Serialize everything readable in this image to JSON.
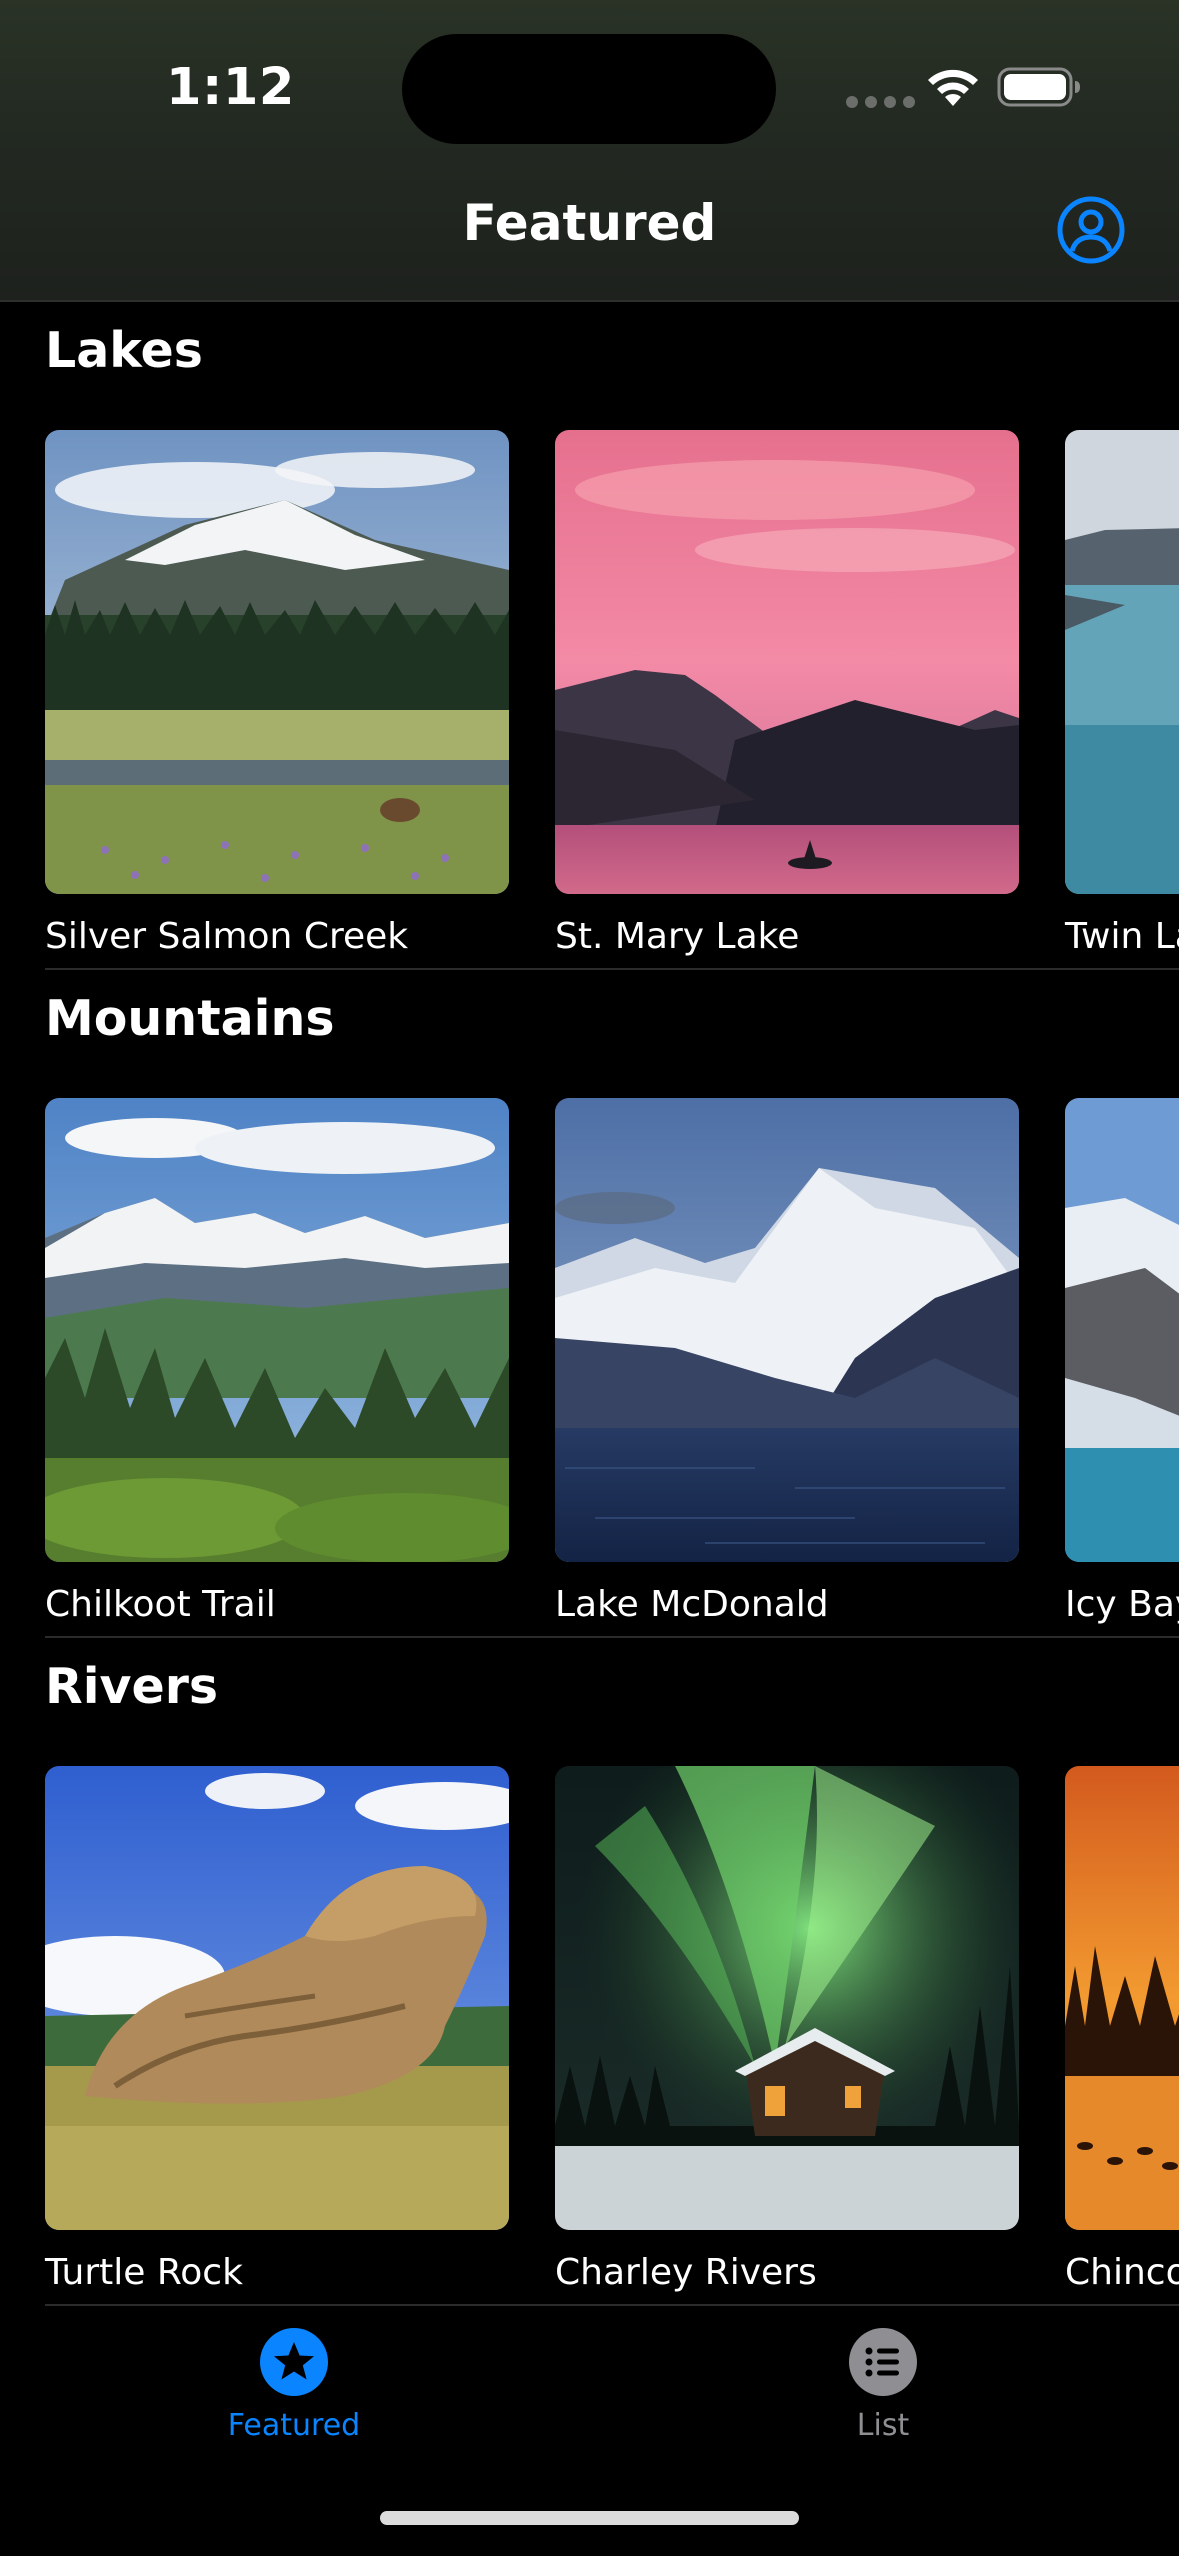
{
  "status_bar": {
    "time": "1:12"
  },
  "nav": {
    "title": "Featured",
    "profile_icon": "person-circle-icon"
  },
  "colors": {
    "accent": "#0a84ff",
    "inactive": "#8e8e93",
    "background": "#000000"
  },
  "sections": [
    {
      "title": "Lakes",
      "items": [
        {
          "name": "Silver Salmon Creek"
        },
        {
          "name": "St. Mary Lake"
        },
        {
          "name": "Twin Lake"
        }
      ]
    },
    {
      "title": "Mountains",
      "items": [
        {
          "name": "Chilkoot Trail"
        },
        {
          "name": "Lake McDonald"
        },
        {
          "name": "Icy Bay"
        }
      ]
    },
    {
      "title": "Rivers",
      "items": [
        {
          "name": "Turtle Rock"
        },
        {
          "name": "Charley Rivers"
        },
        {
          "name": "Chincoteague"
        }
      ]
    }
  ],
  "tabbar": {
    "featured_label": "Featured",
    "featured_icon": "star-circle-icon",
    "list_label": "List",
    "list_icon": "list-bullet-circle-icon"
  }
}
